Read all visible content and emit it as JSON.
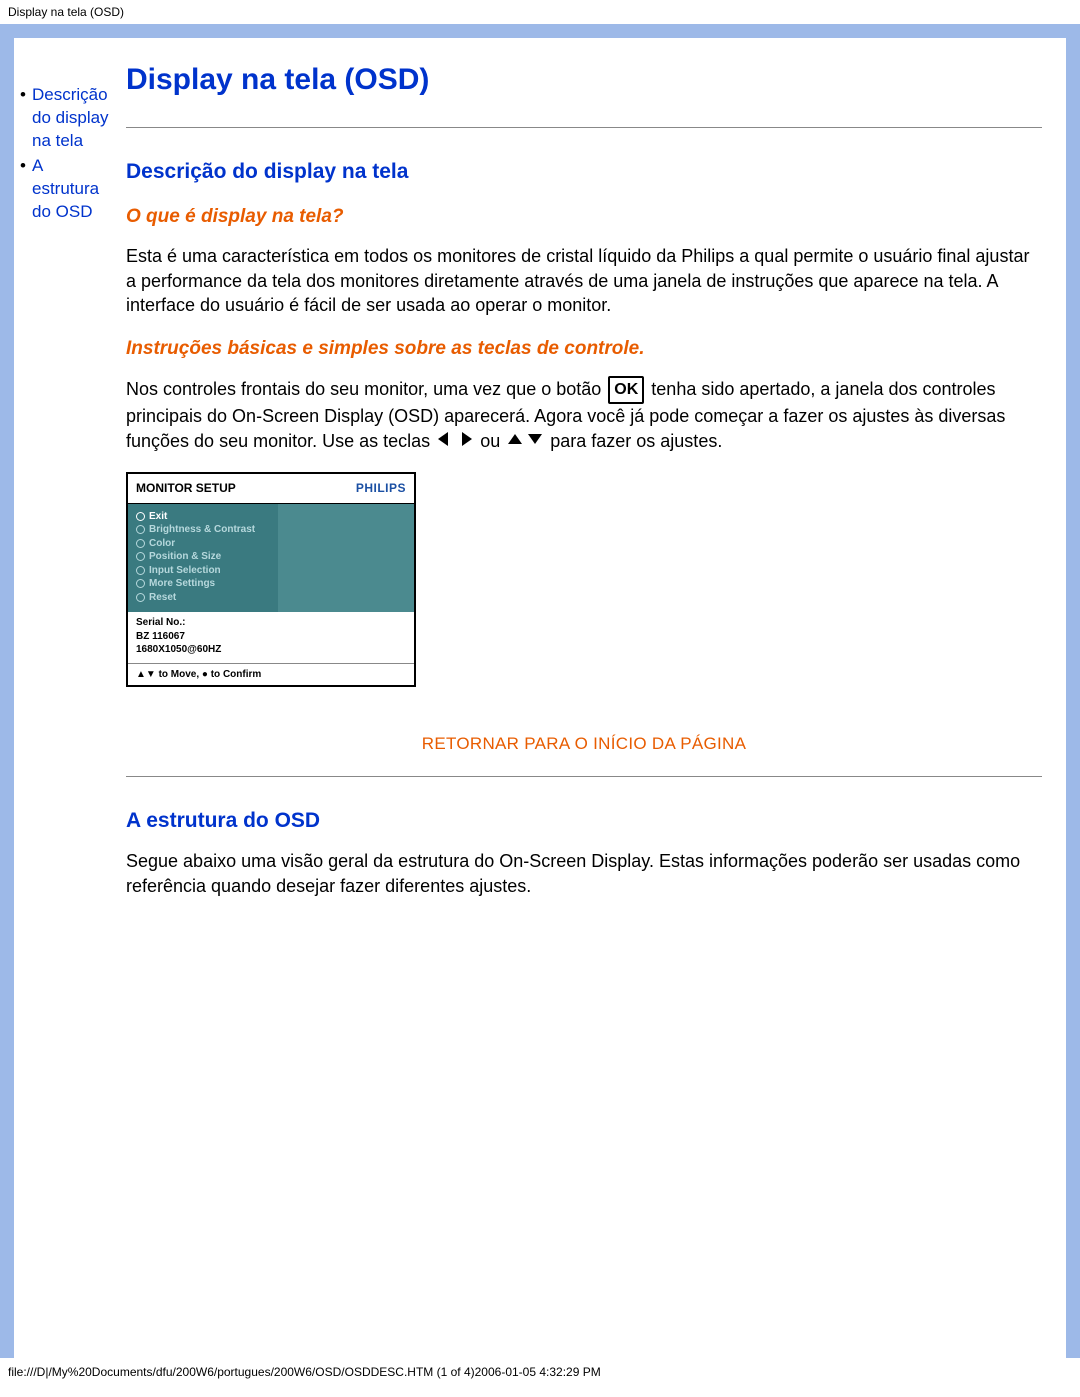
{
  "headerBar": "Display na tela (OSD)",
  "sidebar": {
    "items": [
      {
        "label": "Descrição do display na tela"
      },
      {
        "label": "A estrutura do OSD"
      }
    ]
  },
  "title": "Display na tela (OSD)",
  "section1": {
    "heading": "Descrição do display na tela",
    "sub1": "O que é display na tela?",
    "para1": "Esta é uma característica em todos os monitores de cristal líquido da Philips a qual permite o usuário final ajustar a performance da tela dos monitores diretamente através de uma janela de instruções que aparece na tela. A interface do usuário é fácil de ser usada ao operar o monitor.",
    "sub2": "Instruções básicas e simples sobre as teclas de controle.",
    "p2_a": "Nos controles frontais do seu monitor,  uma vez que o botão ",
    "p2_ok": "OK",
    "p2_b": " tenha sido apertado, a janela dos controles principais do On-Screen Display (OSD) aparecerá. Agora você já pode começar a fazer os ajustes às diversas funções do seu monitor. Use as teclas ",
    "p2_or": " ou ",
    "p2_c": " para fazer os ajustes."
  },
  "osd": {
    "title": "MONITOR SETUP",
    "brand": "PHILIPS",
    "menu": [
      "Exit",
      "Brightness & Contrast",
      "Color",
      "Position & Size",
      "Input Selection",
      "More Settings",
      "Reset"
    ],
    "serialLabel": "Serial No.:",
    "serial": "BZ 116067",
    "res": "1680X1050@60HZ",
    "hint": "▲▼ to Move, ● to Confirm"
  },
  "returnTop": "RETORNAR PARA O INÍCIO DA PÁGINA",
  "section2": {
    "heading": "A estrutura do OSD",
    "para": "Segue abaixo uma visão geral da estrutura do On-Screen Display. Estas informações poderão ser usadas como referência quando desejar fazer diferentes ajustes."
  },
  "footerBar": "file:///D|/My%20Documents/dfu/200W6/portugues/200W6/OSD/OSDDESC.HTM (1 of 4)2006-01-05 4:32:29 PM"
}
